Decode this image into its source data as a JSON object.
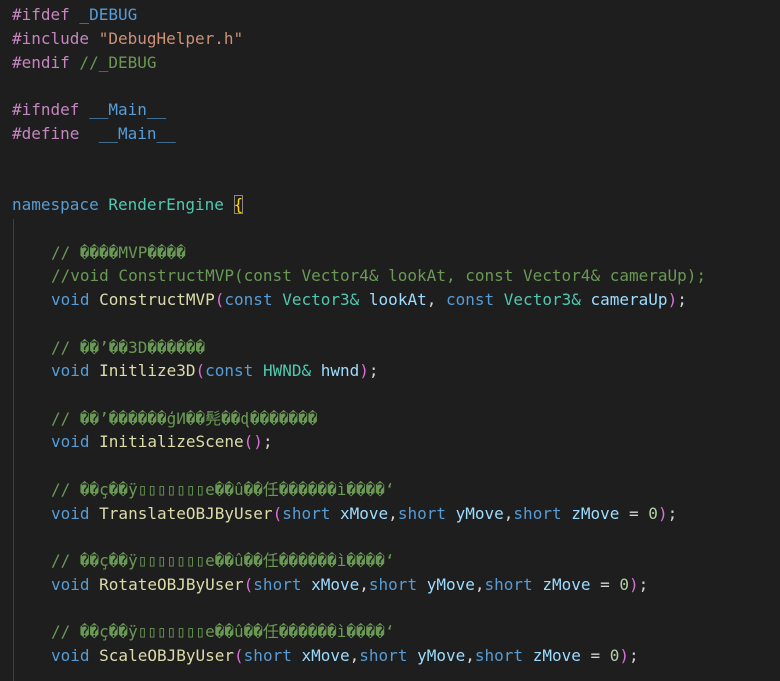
{
  "colors": {
    "background": "#1e1e1e",
    "preprocessor": "#c586c0",
    "macro": "#569cd6",
    "string": "#ce9178",
    "comment": "#6a9955",
    "keyword": "#569cd6",
    "type": "#4ec9b0",
    "function": "#dcdcaa",
    "parameter": "#9cdcfe",
    "number": "#b5cea8",
    "bracket_outer": "#ffd700",
    "bracket_inner": "#da70d6"
  },
  "code": {
    "l1": {
      "kw": "#ifdef",
      "name": " _DEBUG"
    },
    "l2": {
      "kw": "#include",
      "str": " \"DebugHelper.h\""
    },
    "l3": {
      "kw": "#endif",
      "comment": " //_DEBUG"
    },
    "l5": {
      "kw": "#ifndef",
      "name": " __Main__"
    },
    "l6": {
      "kw": "#define",
      "name": "  __Main__"
    },
    "l9": {
      "kw": "namespace",
      "name": " RenderEngine",
      "space": " ",
      "brace": "{"
    },
    "c1": "// ����MVP����",
    "c2": "//void ConstructMVP(const Vector4& lookAt, const Vector4& cameraUp);",
    "f1": {
      "ret": "void",
      "name": " ConstructMVP",
      "open": "(",
      "k1": "const",
      "t1": " Vector3&",
      "p1": " lookAt",
      "comma1": ", ",
      "k2": "const",
      "t2": " Vector3&",
      "p2": " cameraUp",
      "close": ")",
      "semi": ";"
    },
    "c3": "// ��’��3D������",
    "f2": {
      "ret": "void",
      "name": " Initlize3D",
      "open": "(",
      "k1": "const",
      "t1": " HWND&",
      "p1": " hwnd",
      "close": ")",
      "semi": ";"
    },
    "c4": "// ��’������ģИ��髡��ɖ�������",
    "f3": {
      "ret": "void",
      "name": " InitializeScene",
      "open": "(",
      "close": ")",
      "semi": ";"
    },
    "c5": "// ��ç��ÿ▯▯▯▯▯▯▯e��û��任������ì����‘",
    "f4": {
      "ret": "void",
      "name": " TranslateOBJByUser",
      "open": "(",
      "k1": "short",
      "p1": " xMove",
      "comma1": ",",
      "k2": "short",
      "p2": " yMove",
      "comma2": ",",
      "k3": "short",
      "p3": " zMove",
      "eq": " = ",
      "num": "0",
      "close": ")",
      "semi": ";"
    },
    "c6": "// ��ç��ÿ▯▯▯▯▯▯▯e��û��任������ì����‘",
    "f5": {
      "ret": "void",
      "name": " RotateOBJByUser",
      "open": "(",
      "k1": "short",
      "p1": " xMove",
      "comma1": ",",
      "k2": "short",
      "p2": " yMove",
      "comma2": ",",
      "k3": "short",
      "p3": " zMove",
      "eq": " = ",
      "num": "0",
      "close": ")",
      "semi": ";"
    },
    "c7": "// ��ç��ÿ▯▯▯▯▯▯▯e��û��任������ì����‘",
    "f6": {
      "ret": "void",
      "name": " ScaleOBJByUser",
      "open": "(",
      "k1": "short",
      "p1": " xMove",
      "comma1": ",",
      "k2": "short",
      "p2": " yMove",
      "comma2": ",",
      "k3": "short",
      "p3": " zMove",
      "eq": " = ",
      "num": "0",
      "close": ")",
      "semi": ";"
    }
  }
}
